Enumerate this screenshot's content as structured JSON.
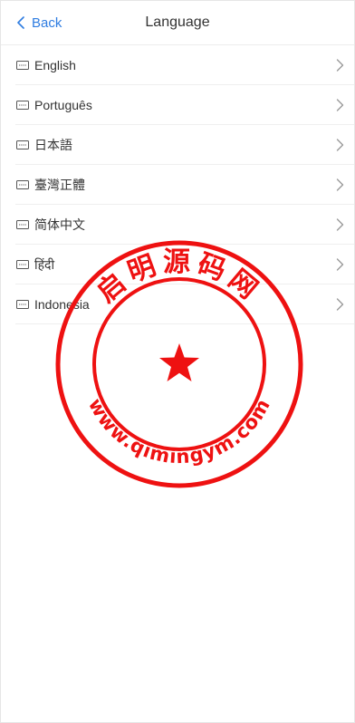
{
  "header": {
    "back_label": "Back",
    "title": "Language"
  },
  "languages": [
    {
      "label": "English"
    },
    {
      "label": "Português"
    },
    {
      "label": "日本語"
    },
    {
      "label": "臺灣正體"
    },
    {
      "label": "简体中文"
    },
    {
      "label": "हिंदी"
    },
    {
      "label": "Indonesia"
    }
  ],
  "icons": {
    "back": "chevron-left-icon",
    "row": "keyboard-icon",
    "row_end": "chevron-right-icon"
  },
  "colors": {
    "accent": "#2f7de1",
    "text": "#333333",
    "chevron": "#999999",
    "divider": "#efefef",
    "stamp": "#ee1111"
  },
  "watermark": {
    "top_text": "启明源码网",
    "bottom_text": "www.qimingym.com"
  }
}
